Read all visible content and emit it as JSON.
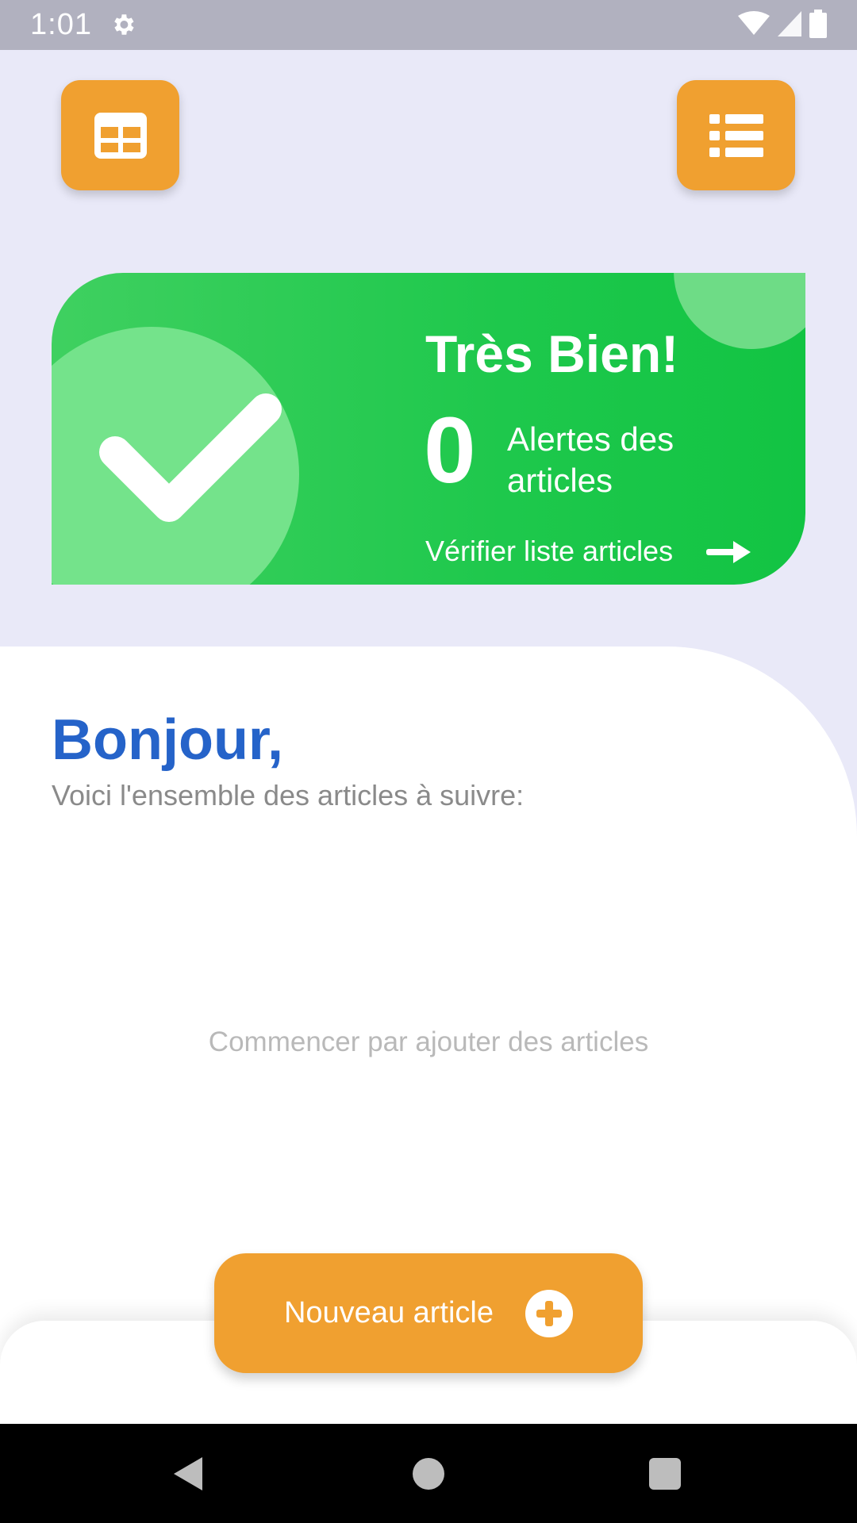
{
  "status_bar": {
    "time": "1:01"
  },
  "card": {
    "title": "Très Bien!",
    "alert_count": "0",
    "alert_label": "Alertes des articles",
    "link_label": "Vérifier liste articles",
    "colors": {
      "accent": "#1ec84c"
    }
  },
  "main": {
    "greeting": "Bonjour,",
    "subtitle": "Voici l'ensemble des articles à suivre:",
    "empty_message": "Commencer par ajouter des articles"
  },
  "fab": {
    "label": "Nouveau article"
  },
  "theme": {
    "primary": "#f0a030",
    "greeting_color": "#2563c9"
  }
}
